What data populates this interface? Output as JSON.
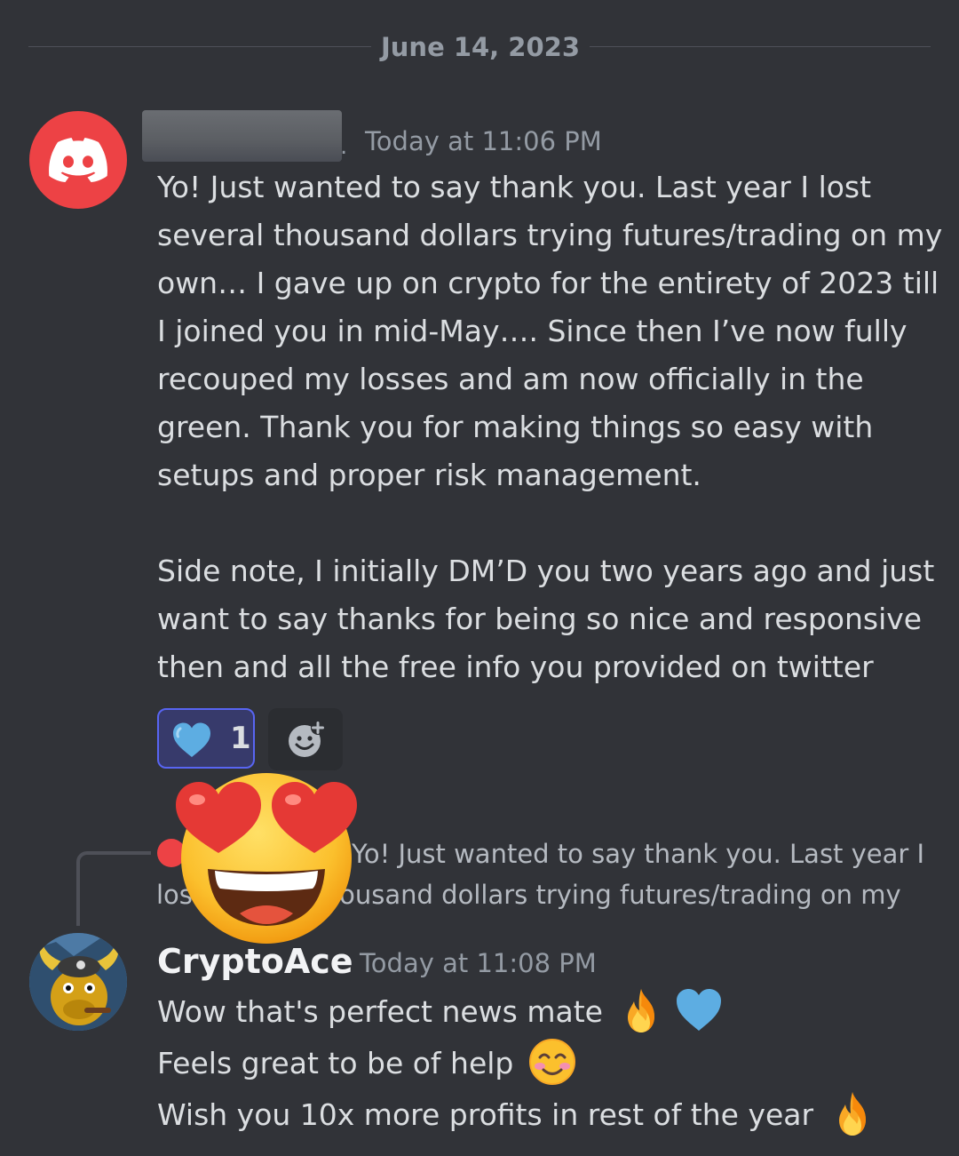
{
  "date_divider": "June 14, 2023",
  "message1": {
    "author_redacted": true,
    "timestamp": "Today at 11:06 PM",
    "paragraphs": [
      "Yo! Just wanted to say thank you. Last year I lost several thousand dollars trying futures/trading on my own… I gave up on crypto for the entirety of 2023 till I joined you in mid-May…. Since then I’ve now fully recouped my losses and am now officially in the green. Thank you for making things so easy with setups and proper risk management.",
      "Side note, I initially DM’D you two years ago and just want to say thanks for being so nice and responsive then and all the free info you provided on twitter"
    ],
    "reaction": {
      "emoji": "blue-heart",
      "count": "1"
    }
  },
  "reply_preview": {
    "text": "Yo! Just wanted to say thank you. Last year I lost several thousand dollars trying futures/trading on my"
  },
  "overlay_emoji": "smiling-face-with-heart-eyes",
  "message2": {
    "author": "CryptoAce",
    "timestamp": "Today at 11:08 PM",
    "lines": [
      {
        "text": "Wow that's perfect news mate",
        "emojis": [
          "fire",
          "blue-heart"
        ]
      },
      {
        "text": "Feels great to be of help",
        "emojis": [
          "smiling-face-with-smiling-eyes"
        ]
      },
      {
        "text": "Wish you 10x more profits in rest of the year",
        "emojis": [
          "fire"
        ]
      }
    ]
  },
  "colors": {
    "background": "#313338",
    "text": "#dbdee1",
    "muted": "#949ba4",
    "avatar_red": "#ed4245",
    "reaction_accent": "#5865f2",
    "heart_blue": "#5dade2"
  }
}
